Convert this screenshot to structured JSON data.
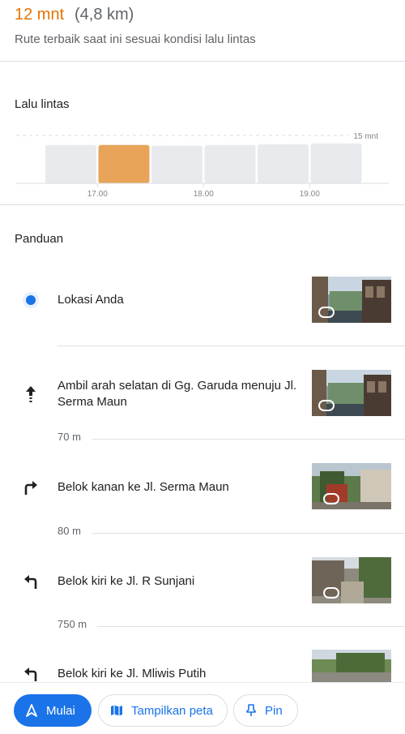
{
  "route": {
    "time": "12 mnt",
    "distance": "(4,8 km)",
    "subtitle": "Rute terbaik saat ini sesuai kondisi lalu lintas"
  },
  "traffic": {
    "title": "Lalu lintas",
    "chart_data": {
      "type": "bar",
      "categories": [
        "",
        "",
        "",
        "",
        "",
        ""
      ],
      "values": [
        12.0,
        12.0,
        11.8,
        12.0,
        12.2,
        12.5
      ],
      "highlight_index": 1,
      "ylim": [
        0,
        15
      ],
      "reference_label": "15 mnt",
      "tick_labels": [
        "17.00",
        "18.00",
        "19.00"
      ],
      "colors": {
        "bar": "#e8eaed",
        "highlight": "#e8a459",
        "axis": "#dadce0"
      }
    }
  },
  "guide": {
    "title": "Panduan",
    "steps": [
      {
        "icon": "location-dot-icon",
        "text": "Lokasi Anda"
      },
      {
        "icon": "arrow-up-icon",
        "text": "Ambil arah selatan di Gg. Garuda menuju Jl. Serma Maun",
        "distance": "70 m"
      },
      {
        "icon": "turn-right-icon",
        "text": "Belok kanan ke Jl. Serma Maun",
        "distance": "80 m"
      },
      {
        "icon": "turn-left-icon",
        "text": "Belok kiri ke Jl. R Sunjani",
        "distance": "750 m"
      },
      {
        "icon": "turn-left-icon",
        "text": "Belok kiri ke Jl. Mliwis Putih"
      }
    ]
  },
  "actions": {
    "start": "Mulai",
    "show_map": "Tampilkan peta",
    "pin": "Pin"
  },
  "colors": {
    "accent": "#1a73e8",
    "time": "#e37400"
  }
}
